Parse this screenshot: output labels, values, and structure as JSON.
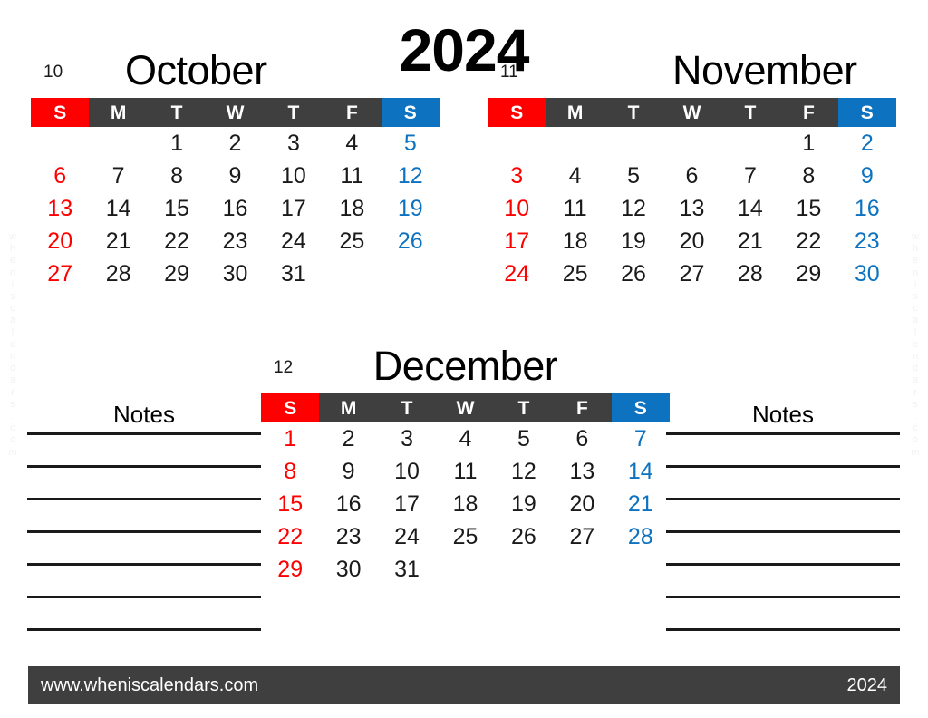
{
  "document": {
    "year_title": "2024",
    "watermark_vertical": "w\nh\ne\nn\ni\ns\nc\na\nl\ne\nn\nd\na\nr\ns\n.\nc\no\nm"
  },
  "weekday_headers": [
    "S",
    "M",
    "T",
    "W",
    "T",
    "F",
    "S"
  ],
  "months": [
    {
      "number": "10",
      "name": "October",
      "first_weekday_index": 2,
      "days": [
        "",
        "",
        "1",
        "2",
        "3",
        "4",
        "5",
        "6",
        "7",
        "8",
        "9",
        "10",
        "11",
        "12",
        "13",
        "14",
        "15",
        "16",
        "17",
        "18",
        "19",
        "20",
        "21",
        "22",
        "23",
        "24",
        "25",
        "26",
        "27",
        "28",
        "29",
        "30",
        "31",
        "",
        ""
      ]
    },
    {
      "number": "11",
      "name": "November",
      "first_weekday_index": 5,
      "days": [
        "",
        "",
        "",
        "",
        "",
        "1",
        "2",
        "3",
        "4",
        "5",
        "6",
        "7",
        "8",
        "9",
        "10",
        "11",
        "12",
        "13",
        "14",
        "15",
        "16",
        "17",
        "18",
        "19",
        "20",
        "21",
        "22",
        "23",
        "24",
        "25",
        "26",
        "27",
        "28",
        "29",
        "30"
      ]
    },
    {
      "number": "12",
      "name": "December",
      "first_weekday_index": 0,
      "days": [
        "1",
        "2",
        "3",
        "4",
        "5",
        "6",
        "7",
        "8",
        "9",
        "10",
        "11",
        "12",
        "13",
        "14",
        "15",
        "16",
        "17",
        "18",
        "19",
        "20",
        "21",
        "22",
        "23",
        "24",
        "25",
        "26",
        "27",
        "28",
        "29",
        "30",
        "31",
        "",
        "",
        "",
        ""
      ]
    }
  ],
  "notes": {
    "title_left": "Notes",
    "title_right": "Notes",
    "line_count": 7
  },
  "footer": {
    "url": "www.wheniscalendars.com",
    "year": "2024"
  },
  "colors": {
    "sunday": "#ff0000",
    "saturday": "#0d72c0",
    "weekday_header": "#3f3f3f",
    "footer_bar": "#3f3f3f",
    "text": "#1a1a1a",
    "background": "#ffffff"
  }
}
